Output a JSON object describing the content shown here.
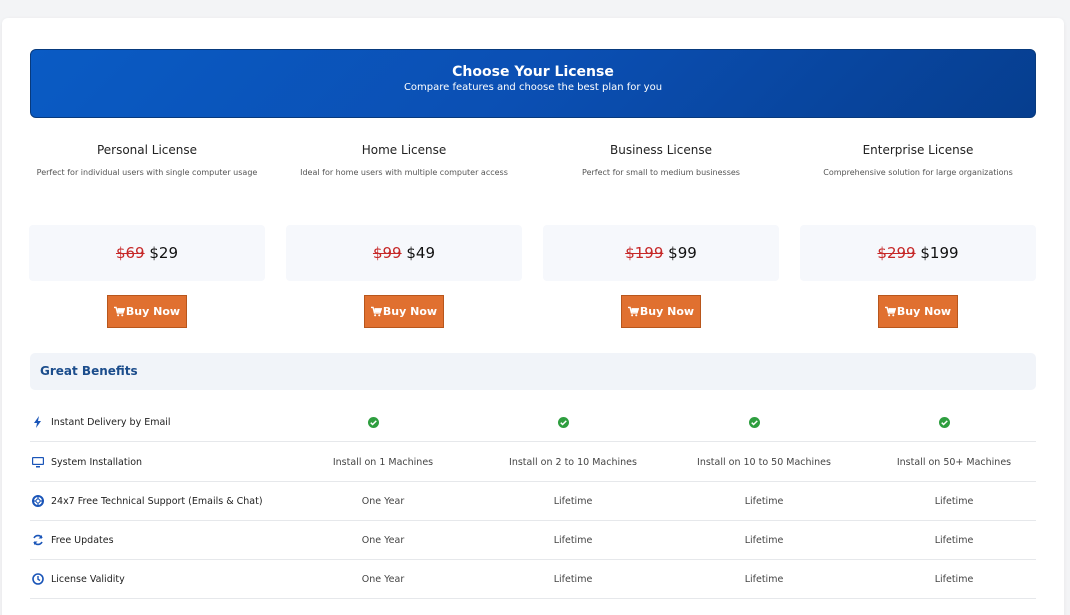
{
  "header": {
    "title": "Choose Your License",
    "subtitle": "Compare features and choose the best plan for you"
  },
  "plans": [
    {
      "name": "Personal License",
      "desc": "Perfect for individual users with single computer usage",
      "old_price": "$69",
      "new_price": "$29",
      "button": "Buy Now"
    },
    {
      "name": "Home License",
      "desc": "Ideal for home users with multiple computer access",
      "old_price": "$99",
      "new_price": "$49",
      "button": "Buy Now"
    },
    {
      "name": "Business License",
      "desc": "Perfect for small to medium businesses",
      "old_price": "$199",
      "new_price": "$99",
      "button": "Buy Now"
    },
    {
      "name": "Enterprise License",
      "desc": "Comprehensive solution for large organizations",
      "old_price": "$299",
      "new_price": "$199",
      "button": "Buy Now"
    }
  ],
  "benefits": {
    "title": "Great Benefits",
    "rows": [
      {
        "icon": "bolt-icon",
        "label": "Instant Delivery by Email",
        "values": [
          "check",
          "check",
          "check",
          "check"
        ]
      },
      {
        "icon": "monitor-icon",
        "label": "System Installation",
        "values": [
          "Install on 1 Machines",
          "Install on 2 to 10 Machines",
          "Install on 10 to 50 Machines",
          "Install on 50+ Machines"
        ]
      },
      {
        "icon": "lifebuoy-icon",
        "label": "24x7 Free Technical Support (Emails & Chat)",
        "values": [
          "One Year",
          "Lifetime",
          "Lifetime",
          "Lifetime"
        ]
      },
      {
        "icon": "sync-icon",
        "label": "Free Updates",
        "values": [
          "One Year",
          "Lifetime",
          "Lifetime",
          "Lifetime"
        ]
      },
      {
        "icon": "clock-icon",
        "label": "License Validity",
        "values": [
          "One Year",
          "Lifetime",
          "Lifetime",
          "Lifetime"
        ]
      }
    ]
  },
  "colors": {
    "header_blue": "#0b4fb3",
    "buy_orange": "#e07030",
    "old_price_red": "#c62828",
    "check_green": "#2e9e3f",
    "benefit_title": "#1c4d8c"
  }
}
